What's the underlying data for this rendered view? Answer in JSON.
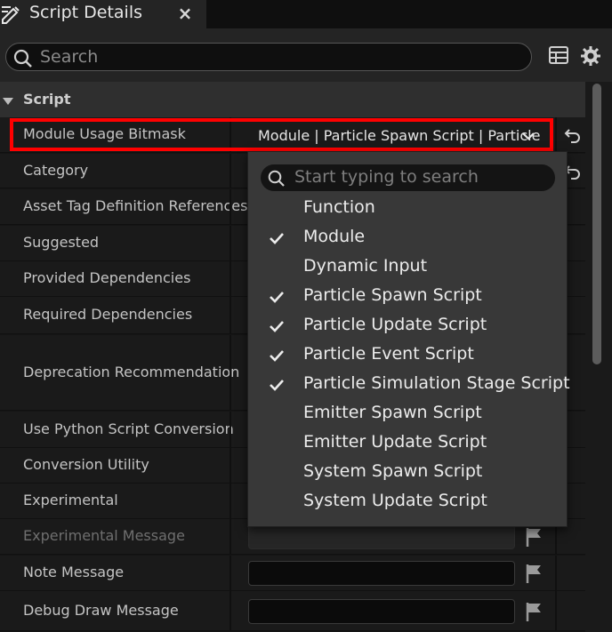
{
  "window": {
    "tab_title": "Script Details",
    "close_glyph": "×"
  },
  "search": {
    "placeholder": "Search"
  },
  "category": {
    "label": "Script"
  },
  "rows": [
    {
      "label": "Module Usage Bitmask",
      "value": "Module | Particle Spawn Script | Particle"
    },
    {
      "label": "Category"
    },
    {
      "label": "Asset Tag Definition References"
    },
    {
      "label": "Suggested"
    },
    {
      "label": "Provided Dependencies"
    },
    {
      "label": "Required Dependencies"
    },
    {
      "label": "Deprecation Recommendation"
    },
    {
      "label": "Use Python Script Conversion"
    },
    {
      "label": "Conversion Utility"
    },
    {
      "label": "Experimental"
    },
    {
      "label": "Experimental Message",
      "disabled": true
    },
    {
      "label": "Note Message"
    },
    {
      "label": "Debug Draw Message"
    }
  ],
  "dropdown": {
    "search_placeholder": "Start typing to search",
    "options": [
      {
        "label": "Function",
        "checked": false
      },
      {
        "label": "Module",
        "checked": true
      },
      {
        "label": "Dynamic Input",
        "checked": false
      },
      {
        "label": "Particle Spawn Script",
        "checked": true
      },
      {
        "label": "Particle Update Script",
        "checked": true
      },
      {
        "label": "Particle Event Script",
        "checked": true
      },
      {
        "label": "Particle Simulation Stage Script",
        "checked": true
      },
      {
        "label": "Emitter Spawn Script",
        "checked": false
      },
      {
        "label": "Emitter Update Script",
        "checked": false
      },
      {
        "label": "System Spawn Script",
        "checked": false
      },
      {
        "label": "System Update Script",
        "checked": false
      }
    ]
  },
  "icons": {
    "tab": "details-pencil-icon",
    "search": "search-icon",
    "table": "table-view-icon",
    "settings": "gear-icon",
    "reset": "reset-to-default-icon",
    "flag": "flag-icon",
    "check": "checkmark-icon",
    "dropdown_chevron": "chevron-down-icon"
  },
  "colors": {
    "highlight": "#ff0000",
    "panel": "#1a1a1a",
    "dropdown": "#383838"
  }
}
